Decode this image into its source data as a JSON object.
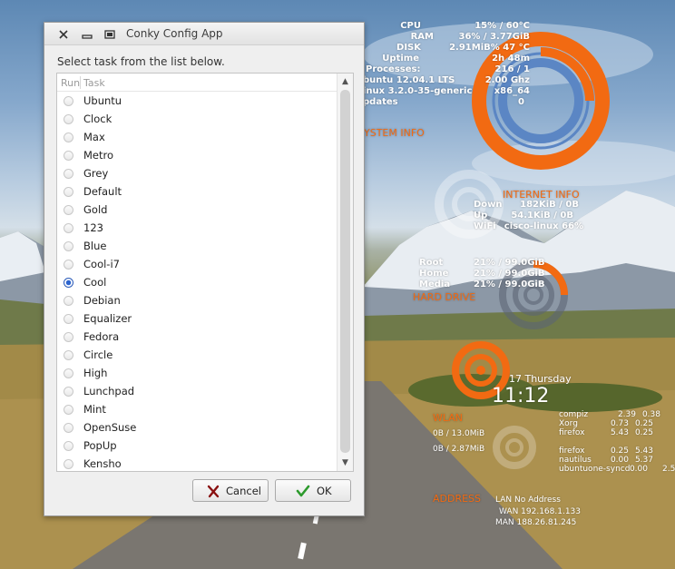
{
  "window": {
    "title": "Conky Config App",
    "prompt": "Select task from the list below.",
    "columns": {
      "run": "Run",
      "task": "Task"
    },
    "tasks": [
      {
        "label": "Ubuntu",
        "selected": false
      },
      {
        "label": "Clock",
        "selected": false
      },
      {
        "label": "Max",
        "selected": false
      },
      {
        "label": "Metro",
        "selected": false
      },
      {
        "label": "Grey",
        "selected": false
      },
      {
        "label": "Default",
        "selected": false
      },
      {
        "label": "Gold",
        "selected": false
      },
      {
        "label": "123",
        "selected": false
      },
      {
        "label": "Blue",
        "selected": false
      },
      {
        "label": "Cool-i7",
        "selected": false
      },
      {
        "label": "Cool",
        "selected": true
      },
      {
        "label": "Debian",
        "selected": false
      },
      {
        "label": "Equalizer",
        "selected": false
      },
      {
        "label": "Fedora",
        "selected": false
      },
      {
        "label": "Circle",
        "selected": false
      },
      {
        "label": "High",
        "selected": false
      },
      {
        "label": "Lunchpad",
        "selected": false
      },
      {
        "label": "Mint",
        "selected": false
      },
      {
        "label": "OpenSuse",
        "selected": false
      },
      {
        "label": "PopUp",
        "selected": false
      },
      {
        "label": "Kensho",
        "selected": false
      }
    ],
    "buttons": {
      "cancel": "Cancel",
      "ok": "OK"
    }
  },
  "conky": {
    "system": {
      "rows": [
        {
          "label": "CPU",
          "value": "15% / 60°C"
        },
        {
          "label": "RAM",
          "value": "36% / 3.77GiB"
        },
        {
          "label": "DISK",
          "value": "2.91MiB% 47 °C"
        },
        {
          "label": "Uptime",
          "value": "2h 48m"
        },
        {
          "label": "Processes:",
          "value": "216 / 1"
        },
        {
          "label": "buntu 12.04.1 LTS",
          "value": "2.00 Ghz"
        },
        {
          "label": "inux 3.2.0-35-generic",
          "value": "x86_64"
        },
        {
          "label": "pdates",
          "value": "0"
        }
      ],
      "heading": "YSTEM INFO"
    },
    "internet": {
      "heading": "INTERNET INFO",
      "rows": [
        {
          "label": "Down",
          "value": "182KiB / 0B"
        },
        {
          "label": "Up",
          "value": "54.1KiB / 0B"
        },
        {
          "label": "WiFi",
          "value": "cisco-linux 66%"
        }
      ]
    },
    "drive": {
      "heading": "HARD DRIVE",
      "rows": [
        {
          "label": "Root",
          "value": "21% / 99.0GiB"
        },
        {
          "label": "Home",
          "value": "21% / 99.0GiB"
        },
        {
          "label": "Media",
          "value": "21% / 99.0GiB"
        }
      ]
    },
    "clock": {
      "date": "17 Thursday",
      "time": "11:12"
    },
    "wlan": {
      "heading": "WLAN",
      "down": "0B /  13.0MiB",
      "up": "0B /  2.87MiB"
    },
    "processes_cpu": [
      {
        "name": "compiz",
        "a": "2.39",
        "b": "0.38"
      },
      {
        "name": "Xorg",
        "a": "0.73",
        "b": "0.25"
      },
      {
        "name": "firefox",
        "a": "5.43",
        "b": "0.25"
      }
    ],
    "processes_mem": [
      {
        "name": "firefox",
        "a": "0.25",
        "b": "5.43"
      },
      {
        "name": "nautilus",
        "a": "0.00",
        "b": "5.37"
      },
      {
        "name": "ubuntuone-syncd",
        "a": "0.00",
        "b": "2.5"
      }
    ],
    "address": {
      "heading": "ADDRESS",
      "lan": "LAN No Address",
      "wan": "WAN 192.168.1.133",
      "man": "MAN 188.26.81.245"
    }
  },
  "colors": {
    "accent": "#f26a12",
    "ring_blue": "#5b86c4",
    "dialog_bg": "#efefef"
  }
}
